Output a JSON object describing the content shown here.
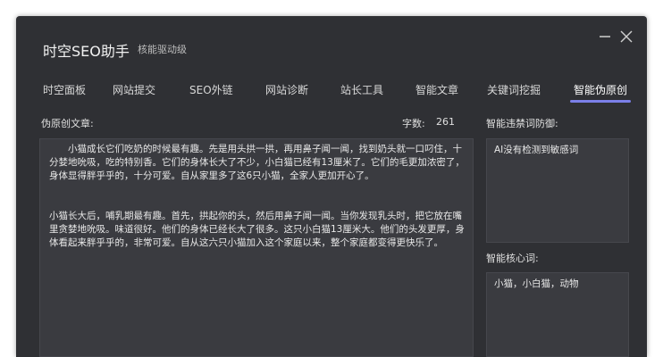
{
  "app": {
    "title": "时空SEO助手",
    "subtitle": "核能驱动级"
  },
  "tabs": [
    {
      "label": "时空面板"
    },
    {
      "label": "网站提交"
    },
    {
      "label": "SEO外链"
    },
    {
      "label": "网站诊断"
    },
    {
      "label": "站长工具"
    },
    {
      "label": "智能文章"
    },
    {
      "label": "关键词挖掘"
    },
    {
      "label": "智能伪原创",
      "active": true
    }
  ],
  "main": {
    "label": "伪原创文章:",
    "wordcount_label": "字数:",
    "wordcount_value": "261",
    "paragraphs": [
      "小猫成长它们吃奶的时候最有趣。先是用头拱一拱，再用鼻子闻一闻，找到奶头就一口叼住，十分婪地吮吸，吃的特别香。它们的身体长大了不少，小白猫已经有13厘米了。它们的毛更加浓密了，身体显得胖乎乎的，十分可爱。自从家里多了这6只小猫，全家人更加开心了。",
      "小猫长大后，哺乳期最有趣。首先，拱起你的头，然后用鼻子闻一闻。当你发现乳头时，把它放在嘴里贪婪地吮吸。味道很好。他们的身体已经长大了很多。这只小白猫13厘米大。他们的头发更厚，身体看起来胖乎乎的，非常可爱。自从这六只小猫加入这个家庭以来，整个家庭都变得更快乐了。"
    ]
  },
  "side": {
    "banned_label": "智能违禁词防御:",
    "banned_value": "AI没有检测到敏感词",
    "keywords_label": "智能核心词:",
    "keywords_value": "小猫，小白猫，动物"
  },
  "icons": {
    "minimize": "minimize-icon",
    "close": "close-icon"
  },
  "colors": {
    "window_bg": "#2f3034",
    "panel_bg": "#3a3b40",
    "accent": "#7b7fe8"
  }
}
